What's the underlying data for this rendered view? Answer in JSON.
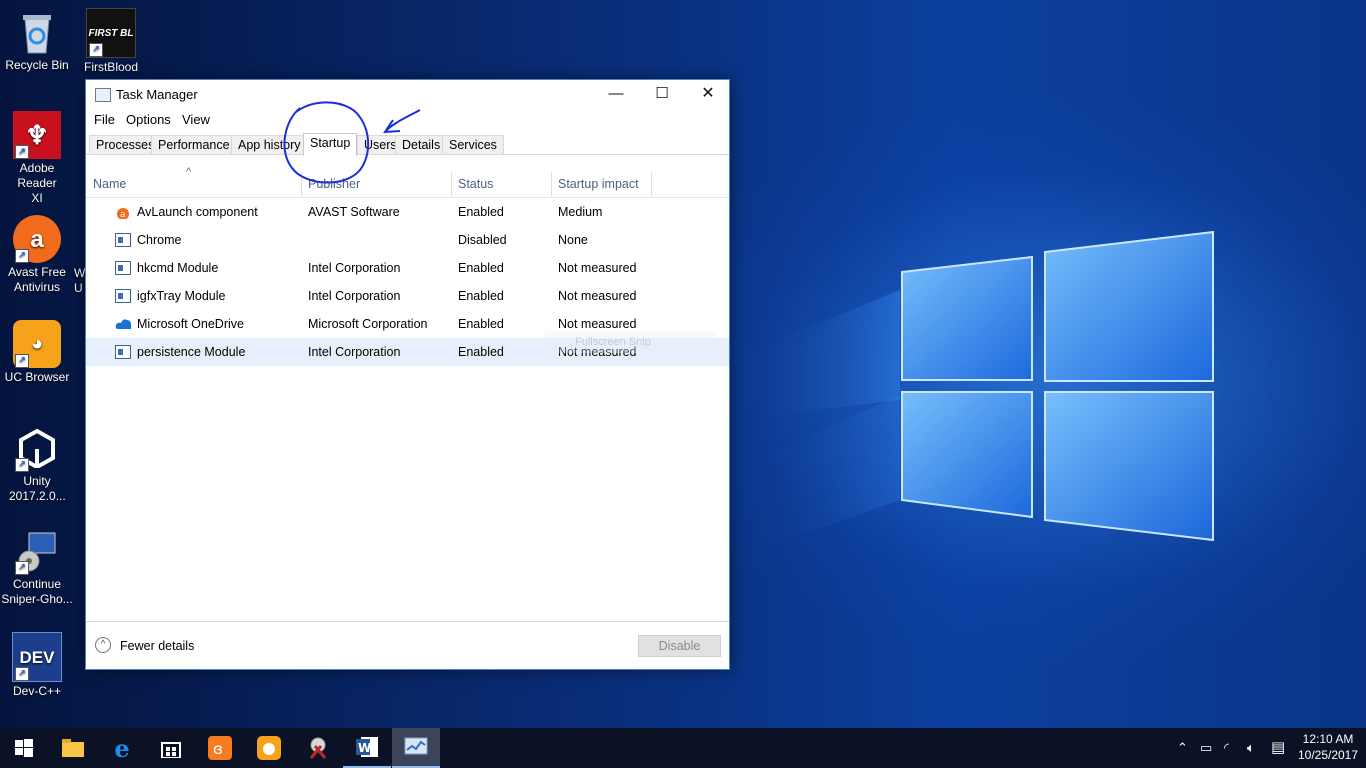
{
  "desktop": {
    "icons": [
      {
        "label": "Recycle Bin",
        "icon": "recycle-bin-icon"
      },
      {
        "label": "FirstBlood",
        "icon": "firstblood-game-icon",
        "glyph_text": "FIRST BL"
      },
      {
        "label": "Adobe Reader XI",
        "icon": "adobe-reader-icon"
      },
      {
        "label": "Avast Free Antivirus",
        "icon": "avast-icon"
      },
      {
        "label": "UC Browser",
        "icon": "uc-browser-icon"
      },
      {
        "label": "Unity 2017.2.0...",
        "icon": "unity-icon"
      },
      {
        "label": "Continue Sniper-Gho...",
        "icon": "sniper-ghost-setup-icon"
      },
      {
        "label": "Dev-C++",
        "icon": "devcpp-icon",
        "glyph_text": "DEV"
      }
    ],
    "partial_label": "W\nU",
    "faded_overlay_text": "Fullscreen Snip"
  },
  "task_manager": {
    "title": "Task Manager",
    "controls": {
      "minimize": "—",
      "maximize": "☐",
      "close": "✕"
    },
    "menu": [
      "File",
      "Options",
      "View"
    ],
    "tabs": [
      "Processes",
      "Performance",
      "App history",
      "Startup",
      "Users",
      "Details",
      "Services"
    ],
    "active_tab": "Startup",
    "columns": {
      "name": "Name",
      "publisher": "Publisher",
      "status": "Status",
      "impact": "Startup impact",
      "sort_indicator": "^"
    },
    "rows": [
      {
        "name": "AvLaunch component",
        "publisher": "AVAST Software",
        "status": "Enabled",
        "impact": "Medium",
        "icon": "avast-orange-icon"
      },
      {
        "name": "Chrome",
        "publisher": "",
        "status": "Disabled",
        "impact": "None",
        "icon": "generic-app-icon"
      },
      {
        "name": "hkcmd Module",
        "publisher": "Intel Corporation",
        "status": "Enabled",
        "impact": "Not measured",
        "icon": "generic-app-icon"
      },
      {
        "name": "igfxTray Module",
        "publisher": "Intel Corporation",
        "status": "Enabled",
        "impact": "Not measured",
        "icon": "generic-app-icon"
      },
      {
        "name": "Microsoft OneDrive",
        "publisher": "Microsoft Corporation",
        "status": "Enabled",
        "impact": "Not measured",
        "icon": "onedrive-cloud-icon"
      },
      {
        "name": "persistence Module",
        "publisher": "Intel Corporation",
        "status": "Enabled",
        "impact": "Not measured",
        "icon": "generic-app-icon",
        "selected": true
      }
    ],
    "footer": {
      "fewer_details": "Fewer details",
      "fewer_icon": "^",
      "disable_button": "Disable"
    }
  },
  "annotation": {
    "color": "#1a2fd6",
    "description_shapes": [
      "circle-around-startup-tab",
      "arrow-pointing-to-startup"
    ]
  },
  "taskbar": {
    "items": [
      "start-windows-icon",
      "file-explorer-icon",
      "edge-browser-icon",
      "store-icon",
      "xampp-icon",
      "uc-browser-icon",
      "snipping-tool-icon",
      "word-icon",
      "task-manager-icon"
    ],
    "active_item": "task-manager-icon",
    "tray": [
      "chevron-up-icon",
      "battery-icon",
      "wifi-icon",
      "volume-icon",
      "notifications-icon"
    ],
    "clock": {
      "time": "12:10 AM",
      "date": "10/25/2017"
    }
  }
}
